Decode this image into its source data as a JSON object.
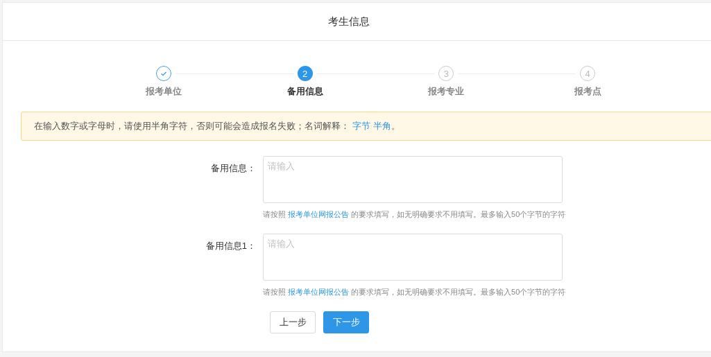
{
  "header": {
    "title": "考生信息"
  },
  "steps": [
    {
      "label": "报考单位",
      "done": true,
      "selected": false
    },
    {
      "label": "备用信息",
      "done": false,
      "selected": true,
      "number": "2"
    },
    {
      "label": "报考专业",
      "done": false,
      "selected": false,
      "number": "3"
    },
    {
      "label": "报考点",
      "done": false,
      "selected": false,
      "number": "4"
    }
  ],
  "notice": {
    "text": "在输入数字或字母时，请使用半角字符，否则可能会造成报名失败；名词解释：",
    "links": [
      "字节",
      "半角"
    ],
    "end": "。"
  },
  "fields": [
    {
      "label": "备用信息：",
      "placeholder": "请输入",
      "hint_before": "请按照 ",
      "hint_link": "报考单位网报公告",
      "hint_after": " 的要求填写，如无明确要求不用填写。最多输入50个字节的字符"
    },
    {
      "label": "备用信息1：",
      "placeholder": "请输入",
      "hint_before": "请按照 ",
      "hint_link": "报考单位网报公告",
      "hint_after": " 的要求填写，如无明确要求不用填写。最多输入50个字节的字符"
    }
  ],
  "buttons": [
    {
      "label": "上一步",
      "kind": "secondary"
    },
    {
      "label": "下一步",
      "kind": "primary"
    }
  ]
}
